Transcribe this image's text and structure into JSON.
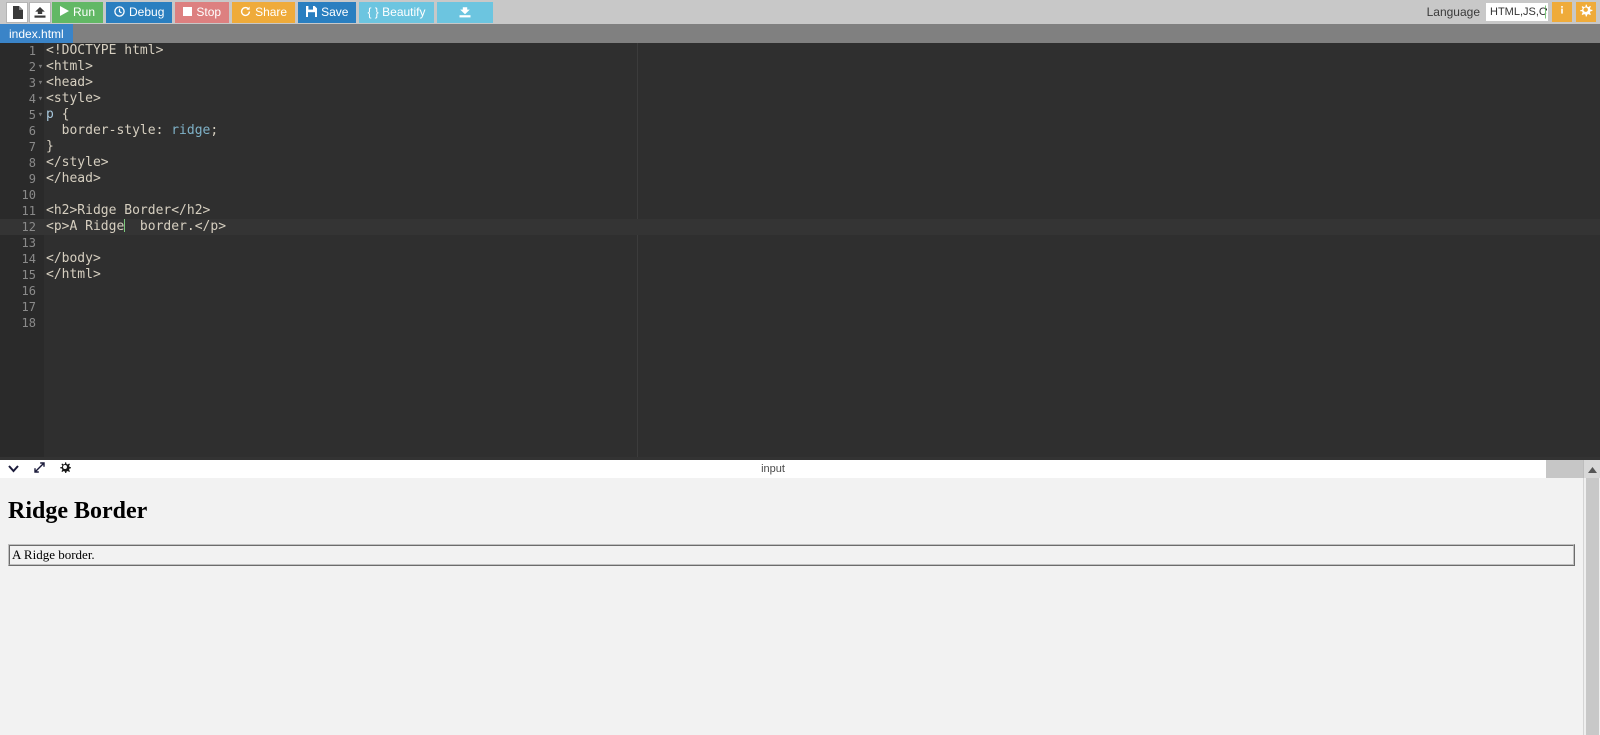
{
  "toolbar": {
    "icon_buttons": [
      {
        "name": "new-file-icon",
        "label": ""
      },
      {
        "name": "upload-icon",
        "label": ""
      }
    ],
    "buttons": [
      {
        "label": "Run",
        "icon": "play-icon",
        "color": "#62b865"
      },
      {
        "label": "Debug",
        "icon": "debug-icon",
        "color": "#2a7fc0"
      },
      {
        "label": "Stop",
        "icon": "stop-icon",
        "color": "#dd8080"
      },
      {
        "label": "Share",
        "icon": "share-icon",
        "color": "#efab3a"
      },
      {
        "label": "Save",
        "icon": "floppy-icon",
        "color": "#2a7fc0"
      },
      {
        "label": "{ } Beautify",
        "icon": "braces-icon",
        "color": "#6cc5e0"
      },
      {
        "label": "",
        "icon": "download-icon",
        "color": "#6cc5e0"
      }
    ],
    "language_label": "Language",
    "language_value": "HTML,JS,C",
    "info_button": "info-icon",
    "settings_button": "gear-icon"
  },
  "tabs": [
    {
      "label": "index.html",
      "active": true
    }
  ],
  "editor": {
    "lines": [
      {
        "num": "1",
        "fold": "",
        "active": false,
        "html": "&lt;!DOCTYPE html&gt;"
      },
      {
        "num": "2",
        "fold": "▾",
        "active": false,
        "html": "&lt;html&gt;"
      },
      {
        "num": "3",
        "fold": "▾",
        "active": false,
        "html": "&lt;head&gt;"
      },
      {
        "num": "4",
        "fold": "▾",
        "active": false,
        "html": "&lt;style&gt;"
      },
      {
        "num": "5",
        "fold": "▾",
        "active": false,
        "html": "<span class=\"tok-sel\">p</span> {"
      },
      {
        "num": "6",
        "fold": "",
        "active": false,
        "html": "  border-style: <span class=\"tok-val\">ridge</span>;"
      },
      {
        "num": "7",
        "fold": "",
        "active": false,
        "html": "}"
      },
      {
        "num": "8",
        "fold": "",
        "active": false,
        "html": "&lt;/style&gt;"
      },
      {
        "num": "9",
        "fold": "",
        "active": false,
        "html": "&lt;/head&gt;"
      },
      {
        "num": "10",
        "fold": "",
        "active": false,
        "html": ""
      },
      {
        "num": "11",
        "fold": "",
        "active": false,
        "html": "&lt;h2&gt;Ridge Border&lt;/h2&gt;"
      },
      {
        "num": "12",
        "fold": "",
        "active": true,
        "html": "&lt;p&gt;A Ridge<span class=\"caret\"></span>  border.&lt;/p&gt;"
      },
      {
        "num": "13",
        "fold": "",
        "active": false,
        "html": ""
      },
      {
        "num": "14",
        "fold": "",
        "active": false,
        "html": "&lt;/body&gt;"
      },
      {
        "num": "15",
        "fold": "",
        "active": false,
        "html": "&lt;/html&gt;"
      },
      {
        "num": "16",
        "fold": "",
        "active": false,
        "html": ""
      },
      {
        "num": "17",
        "fold": "",
        "active": false,
        "html": ""
      },
      {
        "num": "18",
        "fold": "",
        "active": false,
        "html": ""
      }
    ],
    "plain_text": "<!DOCTYPE html>\n<html>\n<head>\n<style>\np {\n  border-style: ridge;\n}\n</style>\n</head>\n\n<h2>Ridge Border</h2>\n<p>A Ridge  border.</p>\n\n</body>\n</html>\n\n\n"
  },
  "output": {
    "title": "input",
    "tool_icons": [
      "chevron-down-icon",
      "expand-icon",
      "gear-icon"
    ],
    "heading": "Ridge Border",
    "paragraph": "A Ridge border."
  },
  "colors": {
    "toolbar_bg": "#c8c8c8",
    "tabbar_bg": "#808080",
    "tab_active": "#3a84c8",
    "editor_bg": "#2f2f2f",
    "gutter_bg": "#2a2a2a",
    "active_line": "#343434",
    "output_bg": "#f2f2f2",
    "accent_orange": "#efab3a"
  }
}
